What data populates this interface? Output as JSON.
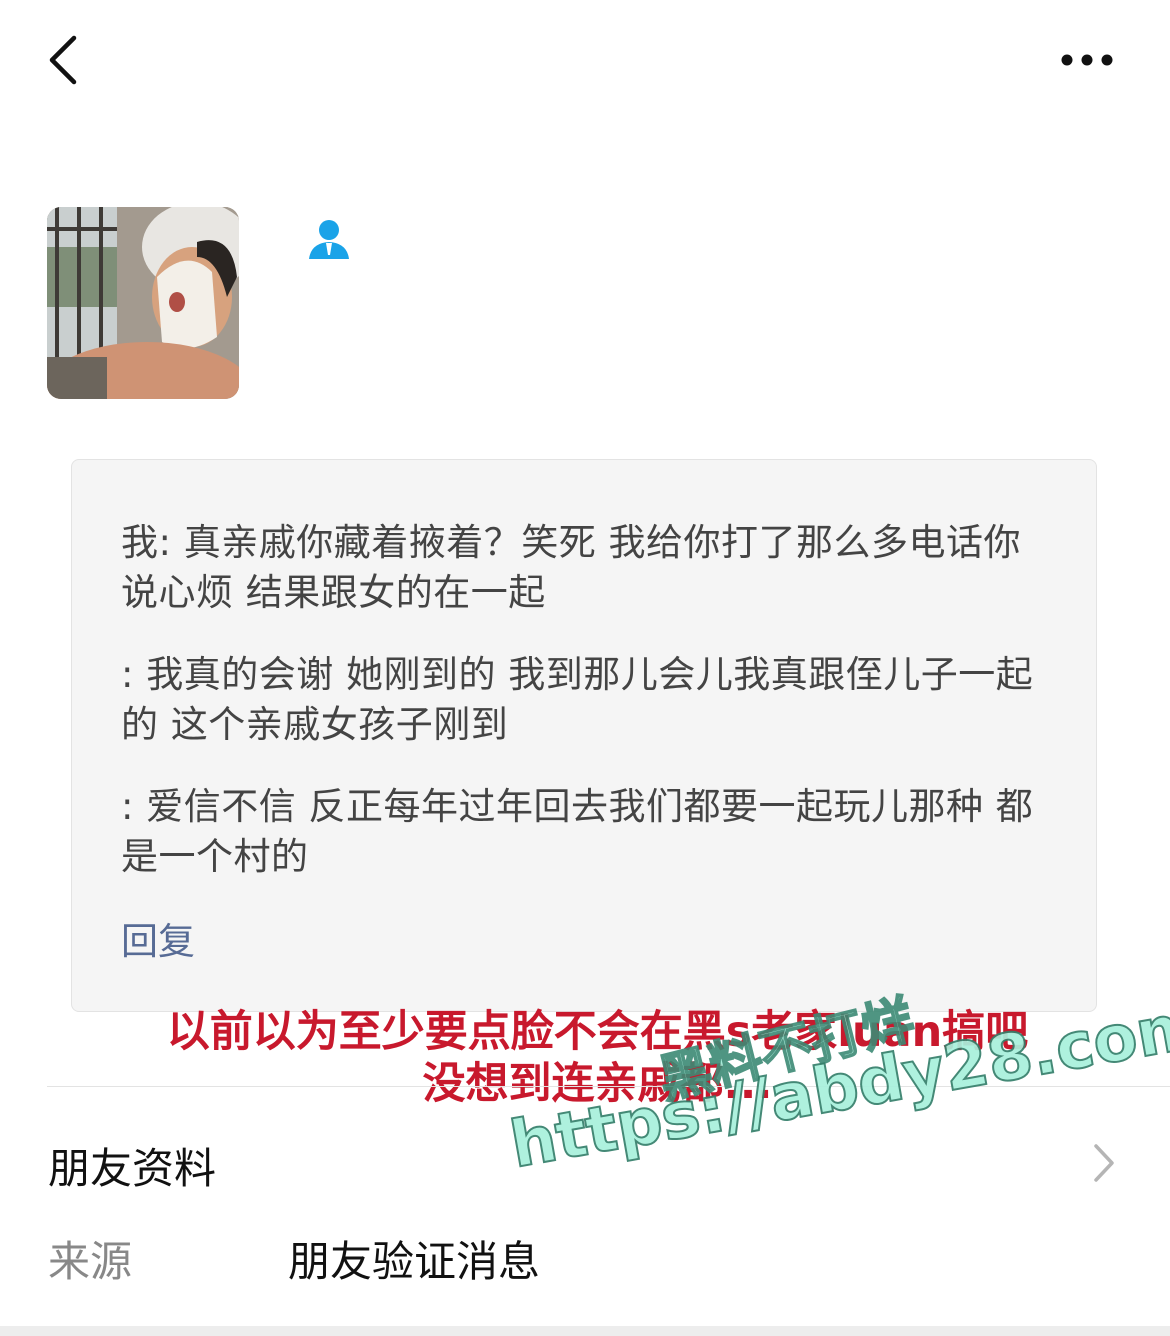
{
  "header": {
    "back_icon": "chevron-left-icon",
    "more_icon": "ellipsis-icon"
  },
  "profile": {
    "avatar": "avatar-photo",
    "contact_icon": "person-icon",
    "contact_icon_color": "#1aa3e8"
  },
  "message_card": {
    "lines": [
      "我: 真亲戚你藏着掖着？笑死 我给你打了那么多电话你说心烦 结果跟女的在一起",
      ": 我真的会谢 她刚到的 我到那儿会儿我真跟侄儿子一起的 这个亲戚女孩子刚到",
      ": 爱信不信 反正每年过年回去我们都要一起玩儿那种 都是一个村的"
    ],
    "reply_label": "回复",
    "reply_color": "#576b95"
  },
  "overlay": {
    "caption": "以前以为至少要点脸不会在黑s老家luan搞吧\n没想到连亲戚都...",
    "caption_color": "#c8192d",
    "watermark_title": "黑料不打烊",
    "watermark_url": "https://abdy28.com"
  },
  "info": {
    "profile_label": "朋友资料",
    "source_label": "来源",
    "source_value": "朋友验证消息"
  }
}
